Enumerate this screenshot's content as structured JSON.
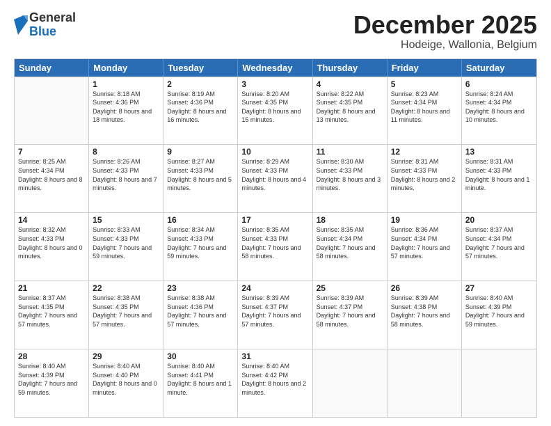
{
  "header": {
    "logo": {
      "general": "General",
      "blue": "Blue"
    },
    "month": "December 2025",
    "location": "Hodeige, Wallonia, Belgium"
  },
  "weekdays": [
    "Sunday",
    "Monday",
    "Tuesday",
    "Wednesday",
    "Thursday",
    "Friday",
    "Saturday"
  ],
  "rows": [
    [
      {
        "day": "",
        "empty": true
      },
      {
        "day": "1",
        "sunrise": "Sunrise: 8:18 AM",
        "sunset": "Sunset: 4:36 PM",
        "daylight": "Daylight: 8 hours and 18 minutes."
      },
      {
        "day": "2",
        "sunrise": "Sunrise: 8:19 AM",
        "sunset": "Sunset: 4:36 PM",
        "daylight": "Daylight: 8 hours and 16 minutes."
      },
      {
        "day": "3",
        "sunrise": "Sunrise: 8:20 AM",
        "sunset": "Sunset: 4:35 PM",
        "daylight": "Daylight: 8 hours and 15 minutes."
      },
      {
        "day": "4",
        "sunrise": "Sunrise: 8:22 AM",
        "sunset": "Sunset: 4:35 PM",
        "daylight": "Daylight: 8 hours and 13 minutes."
      },
      {
        "day": "5",
        "sunrise": "Sunrise: 8:23 AM",
        "sunset": "Sunset: 4:34 PM",
        "daylight": "Daylight: 8 hours and 11 minutes."
      },
      {
        "day": "6",
        "sunrise": "Sunrise: 8:24 AM",
        "sunset": "Sunset: 4:34 PM",
        "daylight": "Daylight: 8 hours and 10 minutes."
      }
    ],
    [
      {
        "day": "7",
        "sunrise": "Sunrise: 8:25 AM",
        "sunset": "Sunset: 4:34 PM",
        "daylight": "Daylight: 8 hours and 8 minutes."
      },
      {
        "day": "8",
        "sunrise": "Sunrise: 8:26 AM",
        "sunset": "Sunset: 4:33 PM",
        "daylight": "Daylight: 8 hours and 7 minutes."
      },
      {
        "day": "9",
        "sunrise": "Sunrise: 8:27 AM",
        "sunset": "Sunset: 4:33 PM",
        "daylight": "Daylight: 8 hours and 5 minutes."
      },
      {
        "day": "10",
        "sunrise": "Sunrise: 8:29 AM",
        "sunset": "Sunset: 4:33 PM",
        "daylight": "Daylight: 8 hours and 4 minutes."
      },
      {
        "day": "11",
        "sunrise": "Sunrise: 8:30 AM",
        "sunset": "Sunset: 4:33 PM",
        "daylight": "Daylight: 8 hours and 3 minutes."
      },
      {
        "day": "12",
        "sunrise": "Sunrise: 8:31 AM",
        "sunset": "Sunset: 4:33 PM",
        "daylight": "Daylight: 8 hours and 2 minutes."
      },
      {
        "day": "13",
        "sunrise": "Sunrise: 8:31 AM",
        "sunset": "Sunset: 4:33 PM",
        "daylight": "Daylight: 8 hours and 1 minute."
      }
    ],
    [
      {
        "day": "14",
        "sunrise": "Sunrise: 8:32 AM",
        "sunset": "Sunset: 4:33 PM",
        "daylight": "Daylight: 8 hours and 0 minutes."
      },
      {
        "day": "15",
        "sunrise": "Sunrise: 8:33 AM",
        "sunset": "Sunset: 4:33 PM",
        "daylight": "Daylight: 7 hours and 59 minutes."
      },
      {
        "day": "16",
        "sunrise": "Sunrise: 8:34 AM",
        "sunset": "Sunset: 4:33 PM",
        "daylight": "Daylight: 7 hours and 59 minutes."
      },
      {
        "day": "17",
        "sunrise": "Sunrise: 8:35 AM",
        "sunset": "Sunset: 4:33 PM",
        "daylight": "Daylight: 7 hours and 58 minutes."
      },
      {
        "day": "18",
        "sunrise": "Sunrise: 8:35 AM",
        "sunset": "Sunset: 4:34 PM",
        "daylight": "Daylight: 7 hours and 58 minutes."
      },
      {
        "day": "19",
        "sunrise": "Sunrise: 8:36 AM",
        "sunset": "Sunset: 4:34 PM",
        "daylight": "Daylight: 7 hours and 57 minutes."
      },
      {
        "day": "20",
        "sunrise": "Sunrise: 8:37 AM",
        "sunset": "Sunset: 4:34 PM",
        "daylight": "Daylight: 7 hours and 57 minutes."
      }
    ],
    [
      {
        "day": "21",
        "sunrise": "Sunrise: 8:37 AM",
        "sunset": "Sunset: 4:35 PM",
        "daylight": "Daylight: 7 hours and 57 minutes."
      },
      {
        "day": "22",
        "sunrise": "Sunrise: 8:38 AM",
        "sunset": "Sunset: 4:35 PM",
        "daylight": "Daylight: 7 hours and 57 minutes."
      },
      {
        "day": "23",
        "sunrise": "Sunrise: 8:38 AM",
        "sunset": "Sunset: 4:36 PM",
        "daylight": "Daylight: 7 hours and 57 minutes."
      },
      {
        "day": "24",
        "sunrise": "Sunrise: 8:39 AM",
        "sunset": "Sunset: 4:37 PM",
        "daylight": "Daylight: 7 hours and 57 minutes."
      },
      {
        "day": "25",
        "sunrise": "Sunrise: 8:39 AM",
        "sunset": "Sunset: 4:37 PM",
        "daylight": "Daylight: 7 hours and 58 minutes."
      },
      {
        "day": "26",
        "sunrise": "Sunrise: 8:39 AM",
        "sunset": "Sunset: 4:38 PM",
        "daylight": "Daylight: 7 hours and 58 minutes."
      },
      {
        "day": "27",
        "sunrise": "Sunrise: 8:40 AM",
        "sunset": "Sunset: 4:39 PM",
        "daylight": "Daylight: 7 hours and 59 minutes."
      }
    ],
    [
      {
        "day": "28",
        "sunrise": "Sunrise: 8:40 AM",
        "sunset": "Sunset: 4:39 PM",
        "daylight": "Daylight: 7 hours and 59 minutes."
      },
      {
        "day": "29",
        "sunrise": "Sunrise: 8:40 AM",
        "sunset": "Sunset: 4:40 PM",
        "daylight": "Daylight: 8 hours and 0 minutes."
      },
      {
        "day": "30",
        "sunrise": "Sunrise: 8:40 AM",
        "sunset": "Sunset: 4:41 PM",
        "daylight": "Daylight: 8 hours and 1 minute."
      },
      {
        "day": "31",
        "sunrise": "Sunrise: 8:40 AM",
        "sunset": "Sunset: 4:42 PM",
        "daylight": "Daylight: 8 hours and 2 minutes."
      },
      {
        "day": "",
        "empty": true
      },
      {
        "day": "",
        "empty": true
      },
      {
        "day": "",
        "empty": true
      }
    ]
  ]
}
